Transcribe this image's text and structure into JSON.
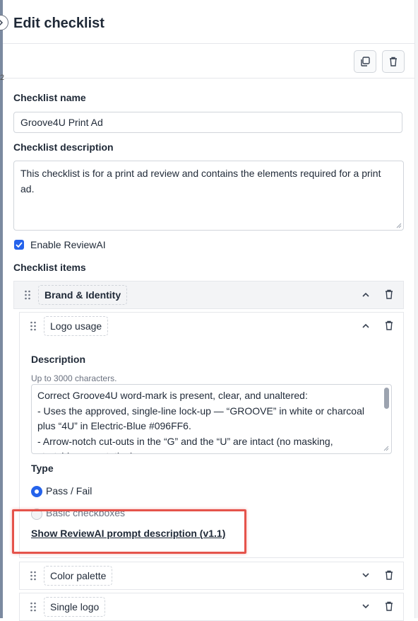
{
  "header": {
    "title": "Edit checklist",
    "stray_glyph": "2"
  },
  "form": {
    "name_label": "Checklist name",
    "name_value": "Groove4U Print Ad",
    "description_label": "Checklist description",
    "description_value": "This checklist is for a print ad review and contains the elements required for a print ad.",
    "enable_reviewai_label": "Enable ReviewAI",
    "enable_reviewai_checked": true,
    "items_label": "Checklist items"
  },
  "groups": [
    {
      "name": "Brand & Identity",
      "expanded": true,
      "items": [
        {
          "name": "Logo usage",
          "expanded": true,
          "description_label": "Description",
          "description_hint": "Up to 3000 characters.",
          "description_value": "Correct Groove4U word-mark is present, clear, and unaltered:\n- Uses the approved, single-line lock-up — “GROOVE” in white or charcoal plus “4U” in Electric-Blue #096FF6.\n- Arrow-notch cut-outs in the “G” and the “U” are intact (no masking, stretching, or rotation).",
          "type_label": "Type",
          "type_options": [
            "Pass / Fail",
            "Basic checkboxes"
          ],
          "type_selected": "Pass / Fail",
          "prompt_link": "Show ReviewAI prompt description (v1.1)"
        },
        {
          "name": "Color palette",
          "expanded": false
        },
        {
          "name": "Single logo",
          "expanded": false
        }
      ]
    }
  ],
  "colors": {
    "accent": "#2563eb",
    "highlight": "#e5534b"
  },
  "icons": [
    "duplicate-icon",
    "trash-icon",
    "drag-handle-icon",
    "chevron-up-icon",
    "chevron-down-icon",
    "chevron-right-icon",
    "check-icon"
  ]
}
